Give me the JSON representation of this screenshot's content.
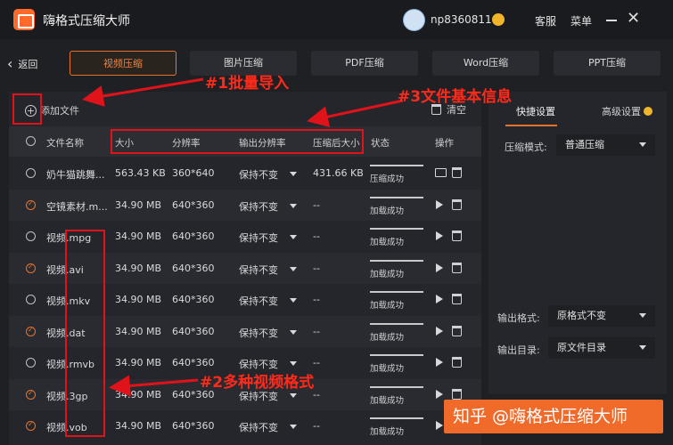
{
  "app": {
    "title": "嗨格式压缩大师",
    "username": "np8360811",
    "service": "客服",
    "menu": "菜单"
  },
  "nav": {
    "back": "返回",
    "tabs": [
      "视频压缩",
      "图片压缩",
      "PDF压缩",
      "Word压缩",
      "PPT压缩"
    ],
    "active_tab": "视频压缩"
  },
  "toolbar": {
    "add_file": "添加文件",
    "clear": "清空"
  },
  "annotations": {
    "a1": "#1批量导入",
    "a2": "#2多种视频格式",
    "a3": "#3文件基本信息"
  },
  "table": {
    "headers": {
      "name": "文件名称",
      "size": "大小",
      "resolution": "分辨率",
      "out_res": "输出分辨率",
      "compressed": "压缩后大小",
      "status": "状态",
      "action": "操作"
    },
    "rows": [
      {
        "name": "奶牛猫跳舞...",
        "size": "563.43 KB",
        "res": "360*640",
        "out": "保持不变",
        "after": "431.66 KB",
        "status": "压缩成功",
        "checked": false,
        "done": true
      },
      {
        "name": "空镜素材.m...",
        "size": "34.90 MB",
        "res": "640*360",
        "out": "保持不变",
        "after": "--",
        "status": "加载成功",
        "checked": true,
        "done": false
      },
      {
        "name": "视频.mpg",
        "size": "34.90 MB",
        "res": "640*360",
        "out": "保持不变",
        "after": "--",
        "status": "加载成功",
        "checked": false,
        "done": false
      },
      {
        "name": "视频.avi",
        "size": "34.90 MB",
        "res": "640*360",
        "out": "保持不变",
        "after": "--",
        "status": "加载成功",
        "checked": true,
        "done": false
      },
      {
        "name": "视频.mkv",
        "size": "34.90 MB",
        "res": "640*360",
        "out": "保持不变",
        "after": "--",
        "status": "加载成功",
        "checked": false,
        "done": false
      },
      {
        "name": "视频.dat",
        "size": "34.90 MB",
        "res": "640*360",
        "out": "保持不变",
        "after": "--",
        "status": "加载成功",
        "checked": true,
        "done": false
      },
      {
        "name": "视频.rmvb",
        "size": "34.90 MB",
        "res": "640*360",
        "out": "保持不变",
        "after": "--",
        "status": "加载成功",
        "checked": false,
        "done": false
      },
      {
        "name": "视频.3gp",
        "size": "34.90 MB",
        "res": "640*360",
        "out": "保持不变",
        "after": "--",
        "status": "加载成功",
        "checked": true,
        "done": false
      },
      {
        "name": "视频.vob",
        "size": "34.90 MB",
        "res": "640*360",
        "out": "保持不变",
        "after": "--",
        "status": "加载成功",
        "checked": true,
        "done": false
      }
    ]
  },
  "settings": {
    "tab_quick": "快捷设置",
    "tab_advanced": "高级设置",
    "mode_label": "压缩模式:",
    "mode_value": "普通压缩",
    "format_label": "输出格式:",
    "format_value": "原格式不变",
    "dir_label": "输出目录:",
    "dir_value": "原文件目录"
  },
  "watermark": "知乎 @嗨格式压缩大师",
  "colors": {
    "accent": "#e5732d",
    "annotation": "#e0131a",
    "background": "#1f2024"
  }
}
